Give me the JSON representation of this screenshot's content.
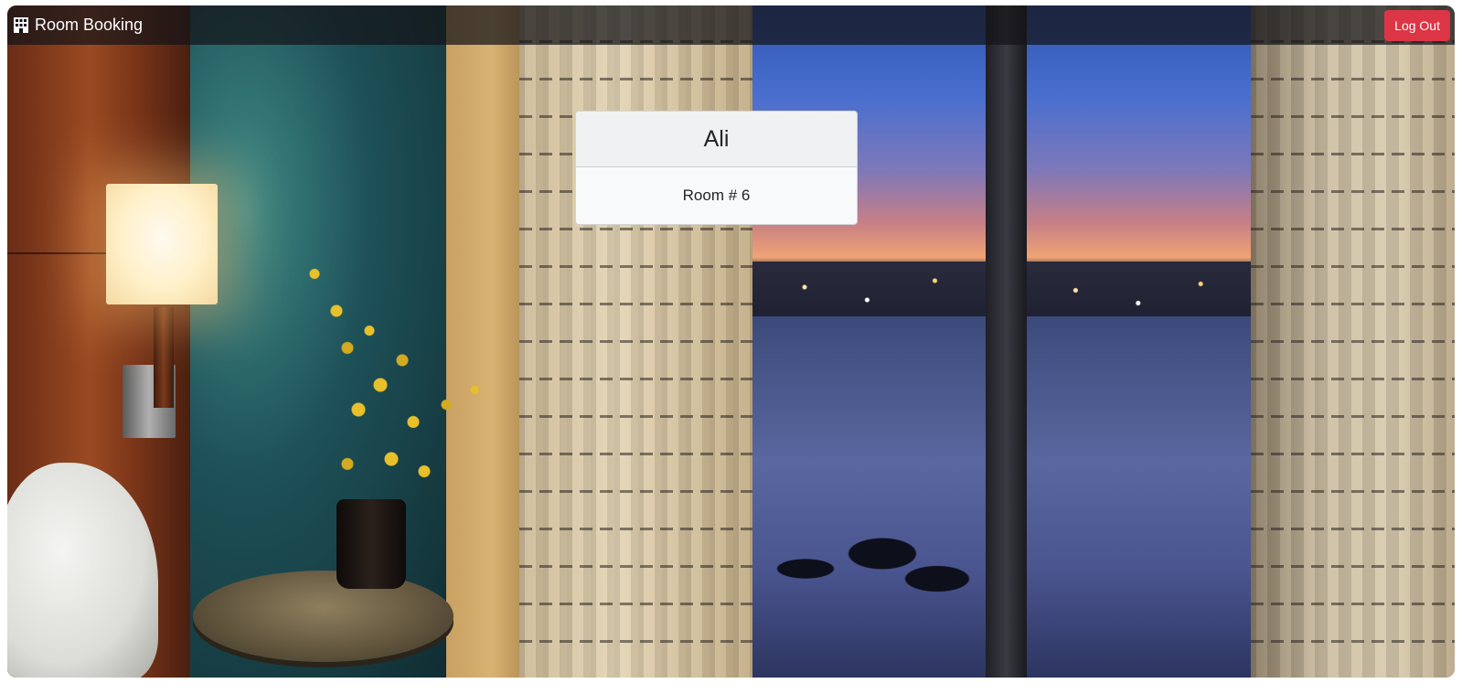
{
  "navbar": {
    "brand_label": "Room Booking",
    "brand_icon": "building-icon",
    "logout_label": "Log Out"
  },
  "card": {
    "guest_name": "Ali",
    "room_label": "Room # 6"
  },
  "colors": {
    "navbar_bg": "#141418",
    "logout_button": "#dc3545",
    "card_bg": "#f8f9fa",
    "card_header_bg": "#f0f1f3"
  }
}
